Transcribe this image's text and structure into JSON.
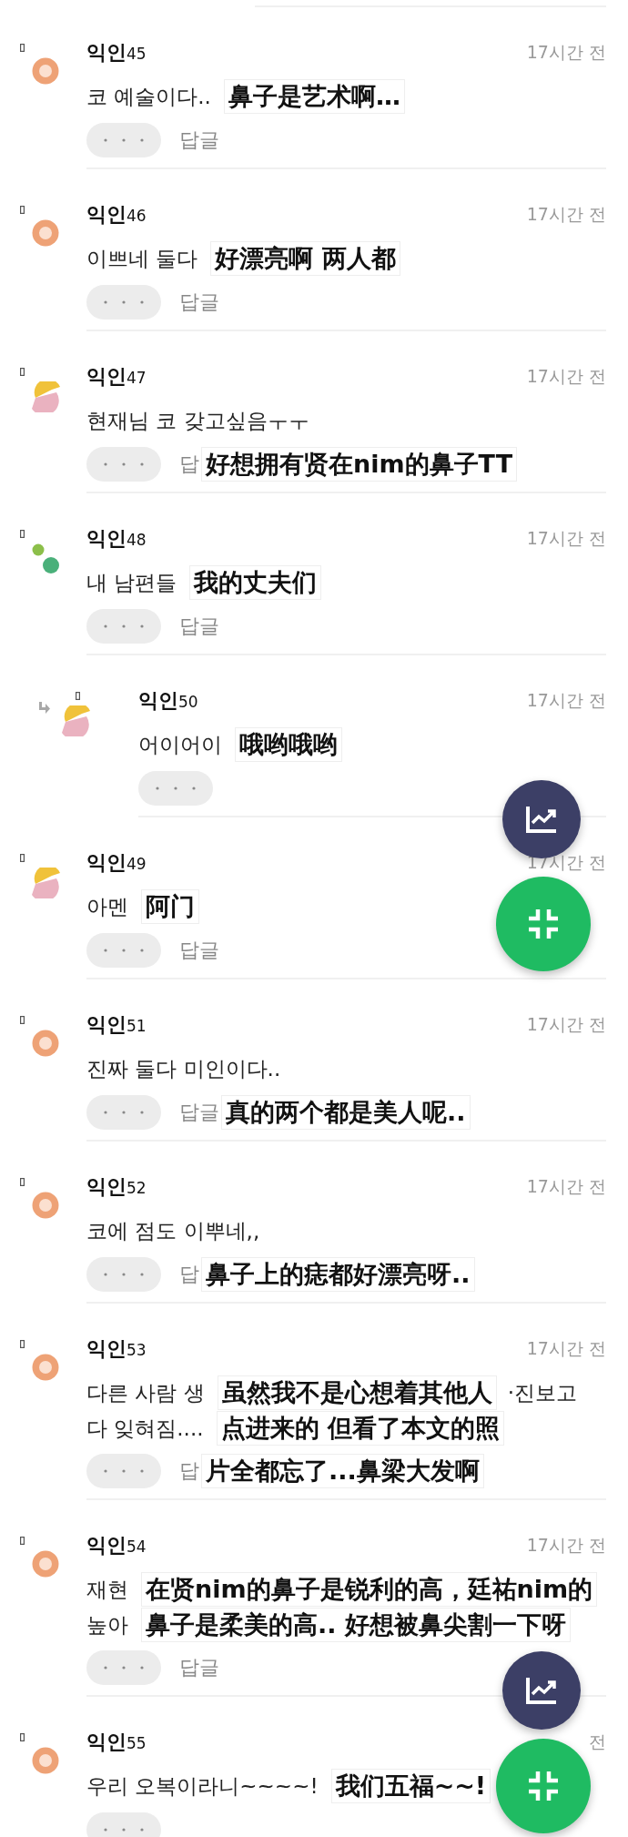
{
  "comments": [
    {
      "kind": "comment",
      "avatar": {
        "kind": "orange"
      },
      "author": "익인",
      "number": "45",
      "time": "17시간 전",
      "lines": [
        [
          {
            "kind": "korean",
            "text": "코 예술이다.."
          },
          {
            "kind": "translation",
            "text": "鼻子是艺术啊…"
          }
        ]
      ],
      "reply": "답글"
    },
    {
      "kind": "comment",
      "avatar": {
        "kind": "orange"
      },
      "author": "익인",
      "number": "46",
      "time": "17시간 전",
      "lines": [
        [
          {
            "kind": "korean",
            "text": "이쁘네 둘다"
          },
          {
            "kind": "translation",
            "text": "好漂亮啊 两人都"
          }
        ]
      ],
      "reply": "답글"
    },
    {
      "kind": "comment",
      "avatar": {
        "kind": "yellow_pink"
      },
      "author": "익인",
      "number": "47",
      "time": "17시간 전",
      "lines": [
        [
          {
            "kind": "korean",
            "text": "현재님 코 갖고싶음ㅜㅜ"
          }
        ]
      ],
      "reply": "답",
      "action_extras": [
        {
          "kind": "translation",
          "text": "好想拥有贤在nim的鼻子TT"
        }
      ]
    },
    {
      "kind": "comment",
      "avatar": {
        "kind": "green_dots"
      },
      "author": "익인",
      "number": "48",
      "time": "17시간 전",
      "lines": [
        [
          {
            "kind": "korean",
            "text": "내 남편들"
          },
          {
            "kind": "translation",
            "text": "我的丈夫们"
          }
        ]
      ],
      "reply": "답글"
    },
    {
      "kind": "reply",
      "avatar": {
        "kind": "yellow_pink"
      },
      "author": "익인",
      "number": "50",
      "time": "17시간 전",
      "lines": [
        [
          {
            "kind": "korean",
            "text": "어이어이"
          },
          {
            "kind": "translation",
            "text": "哦哟哦哟"
          }
        ]
      ]
    },
    {
      "kind": "comment",
      "avatar": {
        "kind": "yellow_pink"
      },
      "author": "익인",
      "number": "49",
      "time": "17시간 전",
      "lines": [
        [
          {
            "kind": "korean",
            "text": "아멘"
          },
          {
            "kind": "translation",
            "text": "阿门"
          }
        ]
      ],
      "reply": "답글"
    },
    {
      "kind": "comment",
      "avatar": {
        "kind": "orange"
      },
      "author": "익인",
      "number": "51",
      "time": "17시간 전",
      "lines": [
        [
          {
            "kind": "korean",
            "text": "진짜 둘다 미인이다.."
          }
        ]
      ],
      "reply": "답글",
      "action_extras": [
        {
          "kind": "translation",
          "text": "真的两个都是美人呢.."
        }
      ]
    },
    {
      "kind": "comment",
      "avatar": {
        "kind": "orange"
      },
      "author": "익인",
      "number": "52",
      "time": "17시간 전",
      "lines": [
        [
          {
            "kind": "korean",
            "text": "코에 점도 이뿌네,,"
          }
        ]
      ],
      "reply": "답",
      "action_extras": [
        {
          "kind": "translation",
          "text": "鼻子上的痣都好漂亮呀.."
        }
      ]
    },
    {
      "kind": "comment",
      "avatar": {
        "kind": "orange"
      },
      "author": "익인",
      "number": "53",
      "time": "17시간 전",
      "lines": [
        [
          {
            "kind": "korean",
            "text": "다른 사람 생"
          },
          {
            "kind": "translation",
            "text": "虽然我不是心想着其他人"
          },
          {
            "kind": "korean",
            "text": "·진보고"
          }
        ],
        [
          {
            "kind": "korean",
            "text": "다 잊혀짐...."
          },
          {
            "kind": "translation",
            "text": "点进来的 但看了本文的照"
          }
        ]
      ],
      "reply": "답",
      "action_extras": [
        {
          "kind": "translation",
          "text": "片全都忘了...鼻梁大发啊"
        }
      ]
    },
    {
      "kind": "comment",
      "avatar": {
        "kind": "orange"
      },
      "author": "익인",
      "number": "54",
      "time": "17시간 전",
      "lines": [
        [
          {
            "kind": "korean",
            "text": "재현"
          },
          {
            "kind": "translation",
            "text": "在贤nim的鼻子是锐利的高，廷祐nim的"
          }
        ],
        [
          {
            "kind": "korean",
            "text": "높아"
          },
          {
            "kind": "translation",
            "text": "鼻子是柔美的高.. 好想被鼻尖割一下呀"
          }
        ]
      ],
      "reply": "답글"
    },
    {
      "kind": "comment",
      "avatar": {
        "kind": "orange"
      },
      "author": "익인",
      "number": "55",
      "time": "전",
      "lines": [
        [
          {
            "kind": "korean",
            "text": "우리 오복이라니~~~~!"
          },
          {
            "kind": "translation",
            "text": "我们五福~~!"
          }
        ]
      ]
    }
  ],
  "floating_buttons": [
    {
      "kind": "chart"
    },
    {
      "kind": "collapse"
    },
    {
      "kind": "chart"
    },
    {
      "kind": "collapse"
    }
  ]
}
